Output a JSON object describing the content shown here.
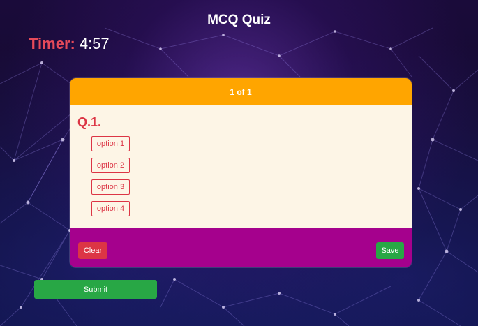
{
  "page": {
    "title": "MCQ Quiz"
  },
  "timer": {
    "label": "Timer:",
    "value": "4:57"
  },
  "quiz": {
    "progress": "1 of 1",
    "question_number": "Q.1.",
    "options": [
      "option 1",
      "option 2",
      "option 3",
      "option 4"
    ],
    "clear_label": "Clear",
    "save_label": "Save"
  },
  "submit_label": "Submit",
  "colors": {
    "header": "#ffa500",
    "body": "#fdf5e6",
    "footer": "#a5018d",
    "danger": "#dc3545",
    "success": "#28a745",
    "timer_label": "#e64a5a"
  }
}
